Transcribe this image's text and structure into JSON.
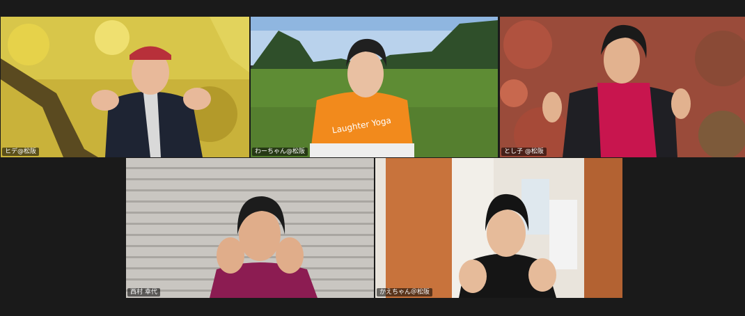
{
  "participants": [
    {
      "name": "ヒデ@松阪",
      "active": true
    },
    {
      "name": "わーちゃん@松阪",
      "active": false,
      "shirt_text": "Laughter Yoga"
    },
    {
      "name": "とし子 @松阪",
      "active": false
    },
    {
      "name": "西村 幸代",
      "active": false
    },
    {
      "name": "かえちゃん＠松阪",
      "active": false
    }
  ],
  "colors": {
    "active_speaker_border": "#f0e442",
    "background": "#1a1a1a",
    "name_tag_bg": "rgba(0,0,0,0.55)"
  }
}
